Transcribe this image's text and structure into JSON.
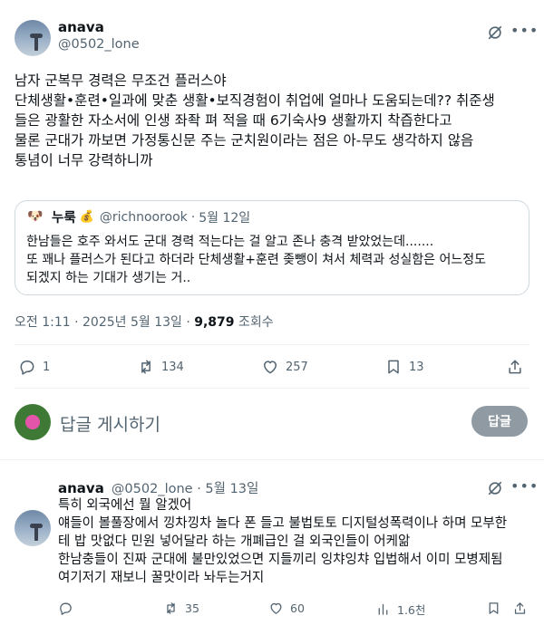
{
  "post": {
    "author_name": "anava",
    "author_handle": "@0502_lone",
    "lines": [
      "남자 군복무 경력은 무조건 플러스야",
      "단체생활•훈련•일과에 맞춘 생활•보직경험이 취업에 얼마나 도움되는데?? 취준생",
      "들은 광활한 자소서에 인생 좌좍 펴 적을 때 6기숙사9 생활까지 착즙한다고",
      "물론 군대가 까보면 가정통신문 주는 군치원이라는 점은 아-무도 생각하지 않음",
      "통념이 너무 강력하니까"
    ],
    "quote": {
      "avatar_glyph": "🐶",
      "author_name": "누룩",
      "name_emoji": "💰",
      "author_handle": "@richnoorook",
      "sep": "·",
      "date": "5월 12일",
      "lines": [
        "한남들은 호주 와서도 군대 경력 적는다는 걸 알고 존나 충격 받았었는데.......",
        "또 꽤나 플러스가 된다고 하더라 단체생활+훈련 좆뺑이 쳐서 체력과 성실함은 어느정도",
        "되겠지 하는 기대가 생기는 거.."
      ]
    },
    "timestamp": "오전 1:11 · 2025년 5월 13일 · ",
    "views_count": "9,879",
    "views_label": " 조회수",
    "actions": {
      "replies": "1",
      "reposts": "134",
      "likes": "257",
      "bookmarks": "13"
    }
  },
  "composer": {
    "placeholder": "답글 게시하기",
    "button_label": "답글"
  },
  "reply": {
    "author_name": "anava",
    "author_handle": "@0502_lone · 5월 13일",
    "lines": [
      "특히 외국에선 뭘 알겠어",
      "얘들이 볼풀장에서 낑차낑차 놀다 폰 들고 불법토토 디지털성폭력이나 하며 모부한",
      "테 밥 맛없다 민원 넣어달라 하는 개폐급인 걸 외국인들이 어케앎",
      "한남충들이 진짜 군대에 불만있었으면 지들끼리 잉챠잉챠 입법해서 이미 모병제됨",
      "여기저기 재보니 꿀맛이라 놔두는거지"
    ],
    "actions": {
      "reposts": "35",
      "likes": "60",
      "views": "1.6천"
    }
  },
  "icons": {
    "more": "more-dots-icon",
    "grok": "grok-icon",
    "reply": "reply-icon",
    "repost": "repost-icon",
    "like": "heart-icon",
    "bookmark": "bookmark-icon",
    "share": "share-icon",
    "views": "bar-chart-icon"
  }
}
